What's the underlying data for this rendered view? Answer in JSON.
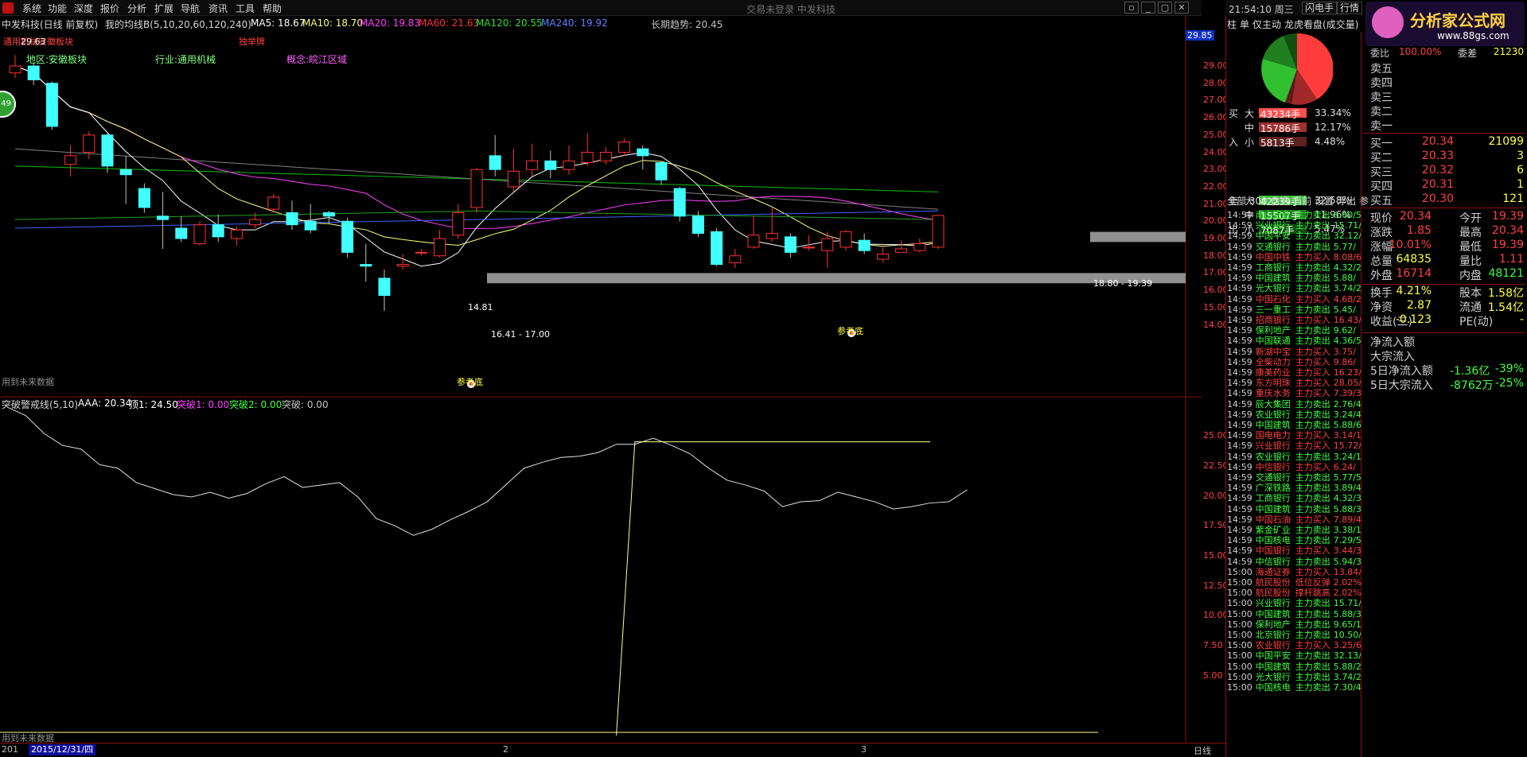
{
  "menu": [
    "系统",
    "功能",
    "深度",
    "报价",
    "分析",
    "扩展",
    "导航",
    "资讯",
    "工具",
    "帮助"
  ],
  "center_title": "交易未登录 中发科技",
  "window_buttons": [
    "▫",
    "_",
    "▢",
    "✕"
  ],
  "header": {
    "stock": "中发科技(日线 前复权)",
    "indicator": "我的均线B(5,10,20,60,120,240)",
    "ma5": "MA5: 18.67",
    "ma10": "MA10: 18.70",
    "ma20": "MA20: 19.83",
    "ma60": "MA60: 21.63",
    "ma120": "MA120: 20.55",
    "ma240": "MA240: 19.92",
    "trend": "长期趋势: 20.45"
  },
  "labels": {
    "sector_top": "通用机械安徽板块",
    "gold": "独举牌",
    "region": "地区:安徽板块",
    "industry": "行业:通用机械",
    "concept": "概念:皖江区域",
    "high_price": "29.63",
    "low_price": "14.81",
    "ref_bottom1": "参考底",
    "ref_bottom2": "参考底",
    "zone1": "16.41 - 17.00",
    "zone2": "18.80 - 19.39",
    "future1": "用到未来数据",
    "future2": "用到未来数据",
    "badge": "49",
    "last_price": "29.85"
  },
  "price_axis": [
    "29.00",
    "28.00",
    "27.00",
    "26.00",
    "25.00",
    "24.00",
    "23.00",
    "22.00",
    "21.00",
    "20.00",
    "19.00",
    "18.00",
    "17.00",
    "16.00",
    "15.00",
    "14.00"
  ],
  "osc_header": {
    "name": "突破警戒线(5,10)",
    "aaa": "AAA: 20.34",
    "top": "顶1: 24.50",
    "b1": "突破1: 0.00",
    "b2": "突破2: 0.00",
    "b3": "突破: 0.00"
  },
  "osc_axis": [
    "25.00",
    "22.50",
    "20.00",
    "17.50",
    "15.00",
    "12.50",
    "10.00",
    "7.50",
    "5.00"
  ],
  "bottom": {
    "year": "201",
    "date": "2015/12/31/四",
    "m2": "2",
    "m3": "3",
    "period": "日线"
  },
  "colors": {
    "up": "#ff3030",
    "down": "#40ffff",
    "ma5": "#ffffff",
    "ma10": "#ffff80",
    "ma20": "#ff40ff",
    "ma60": "#00c000",
    "ma120": "#808080",
    "ma240": "#4060ff"
  },
  "chart_data": [
    {
      "type": "candlestick",
      "series": [
        {
          "o": 28.6,
          "c": 29.0,
          "h": 29.63,
          "l": 28.3
        },
        {
          "o": 29.0,
          "c": 28.2,
          "h": 29.2,
          "l": 27.9
        },
        {
          "o": 28.0,
          "c": 25.5,
          "h": 28.1,
          "l": 25.3
        },
        {
          "o": 23.3,
          "c": 23.8,
          "h": 24.4,
          "l": 22.6
        },
        {
          "o": 24.0,
          "c": 25.0,
          "h": 25.2,
          "l": 23.6
        },
        {
          "o": 25.0,
          "c": 23.2,
          "h": 25.1,
          "l": 22.8
        },
        {
          "o": 23.0,
          "c": 22.7,
          "h": 23.8,
          "l": 21.0
        },
        {
          "o": 21.9,
          "c": 20.8,
          "h": 22.2,
          "l": 20.5
        },
        {
          "o": 20.3,
          "c": 20.1,
          "h": 21.7,
          "l": 18.4
        },
        {
          "o": 19.6,
          "c": 19.0,
          "h": 20.3,
          "l": 18.8
        },
        {
          "o": 18.7,
          "c": 19.8,
          "h": 20.0,
          "l": 18.6
        },
        {
          "o": 19.8,
          "c": 19.1,
          "h": 20.4,
          "l": 18.8
        },
        {
          "o": 19.0,
          "c": 19.5,
          "h": 19.7,
          "l": 18.6
        },
        {
          "o": 19.8,
          "c": 20.1,
          "h": 20.5,
          "l": 19.6
        },
        {
          "o": 20.7,
          "c": 21.4,
          "h": 21.6,
          "l": 20.5
        },
        {
          "o": 20.5,
          "c": 19.8,
          "h": 21.2,
          "l": 19.5
        },
        {
          "o": 20.0,
          "c": 19.5,
          "h": 21.0,
          "l": 19.3
        },
        {
          "o": 20.5,
          "c": 20.3,
          "h": 20.6,
          "l": 19.9
        },
        {
          "o": 20.0,
          "c": 18.2,
          "h": 20.2,
          "l": 17.9
        },
        {
          "o": 17.5,
          "c": 17.4,
          "h": 18.7,
          "l": 16.5
        },
        {
          "o": 16.7,
          "c": 15.7,
          "h": 17.2,
          "l": 14.81
        },
        {
          "o": 17.4,
          "c": 17.5,
          "h": 18.1,
          "l": 17.2
        },
        {
          "o": 18.2,
          "c": 18.2,
          "h": 18.4,
          "l": 18.0
        },
        {
          "o": 18.0,
          "c": 19.0,
          "h": 19.5,
          "l": 17.9
        },
        {
          "o": 19.2,
          "c": 20.5,
          "h": 21.0,
          "l": 19.0
        },
        {
          "o": 20.8,
          "c": 23.0,
          "h": 23.1,
          "l": 20.5
        },
        {
          "o": 23.8,
          "c": 23.0,
          "h": 25.0,
          "l": 22.6
        },
        {
          "o": 22.0,
          "c": 22.9,
          "h": 24.2,
          "l": 21.7
        },
        {
          "o": 23.0,
          "c": 23.5,
          "h": 24.5,
          "l": 22.6
        },
        {
          "o": 23.5,
          "c": 23.0,
          "h": 24.1,
          "l": 22.5
        },
        {
          "o": 23.0,
          "c": 23.5,
          "h": 24.4,
          "l": 22.7
        },
        {
          "o": 23.4,
          "c": 24.0,
          "h": 25.1,
          "l": 23.2
        },
        {
          "o": 23.5,
          "c": 24.0,
          "h": 24.3,
          "l": 23.3
        },
        {
          "o": 24.0,
          "c": 24.6,
          "h": 24.8,
          "l": 23.8
        },
        {
          "o": 24.2,
          "c": 23.8,
          "h": 24.4,
          "l": 23.0
        },
        {
          "o": 23.4,
          "c": 22.4,
          "h": 23.5,
          "l": 22.1
        },
        {
          "o": 21.9,
          "c": 20.3,
          "h": 22.0,
          "l": 20.0
        },
        {
          "o": 20.3,
          "c": 19.3,
          "h": 20.6,
          "l": 19.1
        },
        {
          "o": 19.4,
          "c": 17.5,
          "h": 19.6,
          "l": 17.4
        },
        {
          "o": 17.6,
          "c": 18.0,
          "h": 18.4,
          "l": 17.3
        },
        {
          "o": 18.5,
          "c": 19.2,
          "h": 20.3,
          "l": 18.4
        },
        {
          "o": 19.0,
          "c": 19.3,
          "h": 20.8,
          "l": 18.8
        },
        {
          "o": 19.1,
          "c": 18.2,
          "h": 19.3,
          "l": 17.9
        },
        {
          "o": 18.5,
          "c": 18.5,
          "h": 19.2,
          "l": 18.3
        },
        {
          "o": 18.3,
          "c": 19.0,
          "h": 19.4,
          "l": 17.3
        },
        {
          "o": 18.5,
          "c": 19.4,
          "h": 19.5,
          "l": 18.3
        },
        {
          "o": 18.9,
          "c": 18.3,
          "h": 19.3,
          "l": 18.1
        },
        {
          "o": 17.8,
          "c": 18.1,
          "h": 18.5,
          "l": 17.6
        },
        {
          "o": 18.2,
          "c": 18.4,
          "h": 18.9,
          "l": 18.2
        },
        {
          "o": 18.3,
          "c": 18.7,
          "h": 19.0,
          "l": 18.2
        },
        {
          "o": 18.5,
          "c": 20.34,
          "h": 20.34,
          "l": 18.4
        }
      ]
    },
    {
      "type": "line",
      "name": "突破警戒线",
      "values": [
        27.4,
        26.7,
        25.2,
        24.2,
        23.9,
        22.6,
        22.3,
        21.1,
        20.6,
        20.1,
        19.9,
        20.3,
        19.8,
        20.2,
        21.0,
        21.6,
        20.7,
        20.9,
        21.1,
        19.9,
        18.1,
        17.5,
        16.7,
        17.2,
        18.0,
        18.7,
        19.5,
        20.9,
        22.3,
        22.8,
        23.2,
        23.3,
        23.6,
        24.3,
        24.3,
        24.8,
        24.2,
        23.5,
        22.3,
        21.3,
        20.9,
        20.4,
        19.1,
        19.5,
        19.6,
        20.3,
        19.9,
        19.5,
        18.9,
        19.1,
        19.4,
        19.5,
        20.5
      ],
      "line2": [
        {
          "x": 33,
          "y": 0
        },
        {
          "x": 34,
          "y": 24.5
        },
        {
          "x": 50,
          "y": 24.5
        }
      ],
      "ylim": [
        0,
        27
      ]
    }
  ],
  "right": {
    "clock": "21:54:10 周三",
    "btn1": "闪电手",
    "btn2": "行情",
    "tabs": [
      "柱",
      "单",
      "仅主动",
      "龙虎看盘(成交量)"
    ],
    "fund_rows": [
      {
        "side": "买",
        "size": "大",
        "val": "43234手",
        "pct": "33.34%",
        "color": "#ff5050"
      },
      {
        "side": "",
        "size": "中",
        "val": "15786手",
        "pct": "12.17%",
        "color": "#a03030"
      },
      {
        "side": "入",
        "size": "小",
        "val": "5813手",
        "pct": "4.48%",
        "color": "#602020"
      },
      {
        "side": "卖",
        "size": "大",
        "val": "42239手",
        "pct": "32.58%",
        "color": "#40c040"
      },
      {
        "side": "",
        "size": "中",
        "val": "15507手",
        "pct": "11.96%",
        "color": "#208020"
      },
      {
        "side": "出",
        "size": "小",
        "val": "7087手",
        "pct": "5.47%",
        "color": "#105010"
      }
    ],
    "list_tabs": [
      "全部",
      "300",
      "自选",
      "当前",
      "设置",
      "浮出",
      "参"
    ],
    "ticks": [
      {
        "t": "14:59",
        "n": "南山铝业",
        "a": "主力卖出",
        "v": "6.60/5",
        "buy": false
      },
      {
        "t": "14:59",
        "n": "兴业银行",
        "a": "主力卖出",
        "v": "15.71/",
        "buy": false
      },
      {
        "t": "14:59",
        "n": "中国平安",
        "a": "主力卖出",
        "v": "32.12/",
        "buy": false
      },
      {
        "t": "14:59",
        "n": "交通银行",
        "a": "主力卖出",
        "v": "5.77/",
        "buy": false
      },
      {
        "t": "14:59",
        "n": "中国中铁",
        "a": "主力买入",
        "v": "8.08/6",
        "buy": true
      },
      {
        "t": "14:59",
        "n": "工商银行",
        "a": "主力卖出",
        "v": "4.32/2",
        "buy": false
      },
      {
        "t": "14:59",
        "n": "中国建筑",
        "a": "主力卖出",
        "v": "5.88/",
        "buy": false
      },
      {
        "t": "14:59",
        "n": "光大银行",
        "a": "主力卖出",
        "v": "3.74/2",
        "buy": false
      },
      {
        "t": "14:59",
        "n": "中国石化",
        "a": "主力买入",
        "v": "4.68/2",
        "buy": true
      },
      {
        "t": "14:59",
        "n": "三一重工",
        "a": "主力卖出",
        "v": "5.45/",
        "buy": false
      },
      {
        "t": "14:59",
        "n": "招商银行",
        "a": "主力买入",
        "v": "16.43/",
        "buy": true
      },
      {
        "t": "14:59",
        "n": "保利地产",
        "a": "主力卖出",
        "v": "9.62/",
        "buy": false
      },
      {
        "t": "14:59",
        "n": "中国联通",
        "a": "主力卖出",
        "v": "4.36/5",
        "buy": false
      },
      {
        "t": "14:59",
        "n": "新湖中宝",
        "a": "主力买入",
        "v": "3.75/",
        "buy": true
      },
      {
        "t": "14:59",
        "n": "全柴动力",
        "a": "主力买入",
        "v": "9.86/",
        "buy": true
      },
      {
        "t": "14:59",
        "n": "康美药业",
        "a": "主力买入",
        "v": "16.23/",
        "buy": true
      },
      {
        "t": "14:59",
        "n": "东方明珠",
        "a": "主力买入",
        "v": "28.05/",
        "buy": true
      },
      {
        "t": "14:59",
        "n": "重庆水务",
        "a": "主力买入",
        "v": "7.39/3",
        "buy": true
      },
      {
        "t": "14:59",
        "n": "辰大集团",
        "a": "主力卖出",
        "v": "2.76/4",
        "buy": false
      },
      {
        "t": "14:59",
        "n": "农业银行",
        "a": "主力卖出",
        "v": "3.24/4",
        "buy": false
      },
      {
        "t": "14:59",
        "n": "中国建筑",
        "a": "主力卖出",
        "v": "5.88/6",
        "buy": false
      },
      {
        "t": "14:59",
        "n": "国电电力",
        "a": "主力买入",
        "v": "3.14/1",
        "buy": true
      },
      {
        "t": "14:59",
        "n": "兴业银行",
        "a": "主力买入",
        "v": "15.72/",
        "buy": true
      },
      {
        "t": "14:59",
        "n": "农业银行",
        "a": "主力卖出",
        "v": "3.24/1",
        "buy": false
      },
      {
        "t": "14:59",
        "n": "中信银行",
        "a": "主力买入",
        "v": "6.24/",
        "buy": true
      },
      {
        "t": "14:59",
        "n": "交通银行",
        "a": "主力卖出",
        "v": "5.77/5",
        "buy": false
      },
      {
        "t": "14:59",
        "n": "广深铁路",
        "a": "主力卖出",
        "v": "3.89/4",
        "buy": false
      },
      {
        "t": "14:59",
        "n": "工商银行",
        "a": "主力卖出",
        "v": "4.32/3",
        "buy": false
      },
      {
        "t": "14:59",
        "n": "中国建筑",
        "a": "主力卖出",
        "v": "5.88/3",
        "buy": false
      },
      {
        "t": "14:59",
        "n": "中国石油",
        "a": "主力买入",
        "v": "7.89/4",
        "buy": true
      },
      {
        "t": "14:59",
        "n": "紫金矿业",
        "a": "主力卖出",
        "v": "3.38/1",
        "buy": false
      },
      {
        "t": "14:59",
        "n": "中国核电",
        "a": "主力卖出",
        "v": "7.29/5",
        "buy": false
      },
      {
        "t": "14:59",
        "n": "中国银行",
        "a": "主力买入",
        "v": "3.44/3",
        "buy": true
      },
      {
        "t": "14:59",
        "n": "中信银行",
        "a": "主力卖出",
        "v": "5.94/3",
        "buy": false
      },
      {
        "t": "15:00",
        "n": "海通证券",
        "a": "主力买入",
        "v": "13.84/",
        "buy": true
      },
      {
        "t": "15:00",
        "n": "航民股份",
        "a": "低位反弹",
        "v": "2.02%",
        "buy": true
      },
      {
        "t": "15:00",
        "n": "航民股份",
        "a": "撑杆跳高",
        "v": "2.02%",
        "buy": true
      },
      {
        "t": "15:00",
        "n": "兴业银行",
        "a": "主力卖出",
        "v": "15.71/",
        "buy": false
      },
      {
        "t": "15:00",
        "n": "中国建筑",
        "a": "主力卖出",
        "v": "5.88/3",
        "buy": false
      },
      {
        "t": "15:00",
        "n": "保利地产",
        "a": "主力卖出",
        "v": "9.65/1",
        "buy": false
      },
      {
        "t": "15:00",
        "n": "北京银行",
        "a": "主力卖出",
        "v": "10.50/",
        "buy": false
      },
      {
        "t": "15:00",
        "n": "农业银行",
        "a": "主力买入",
        "v": "3.25/6",
        "buy": true
      },
      {
        "t": "15:00",
        "n": "中国平安",
        "a": "主力卖出",
        "v": "32.13/",
        "buy": false
      },
      {
        "t": "15:00",
        "n": "中国建筑",
        "a": "主力卖出",
        "v": "5.88/2",
        "buy": false
      },
      {
        "t": "15:00",
        "n": "光大银行",
        "a": "主力卖出",
        "v": "3.74/2",
        "buy": false
      },
      {
        "t": "15:00",
        "n": "中国核电",
        "a": "主力卖出",
        "v": "7.30/4",
        "buy": false
      }
    ],
    "committee_label": "委比",
    "committee_val": "100.00%",
    "committee_label2": "委差",
    "committee_val2": "21230",
    "asks": [
      "卖五",
      "卖四",
      "卖三",
      "卖二",
      "卖一"
    ],
    "bids": [
      {
        "l": "买一",
        "p": "20.34",
        "v": "21099"
      },
      {
        "l": "买二",
        "p": "20.33",
        "v": "3"
      },
      {
        "l": "买三",
        "p": "20.32",
        "v": "6"
      },
      {
        "l": "买四",
        "p": "20.31",
        "v": "1"
      },
      {
        "l": "买五",
        "p": "20.30",
        "v": "121"
      }
    ],
    "stats": [
      {
        "a": "现价",
        "b": "20.34",
        "c": "今开",
        "d": "19.39",
        "bc": "#ff4040",
        "dc": "#ff4040"
      },
      {
        "a": "涨跌",
        "b": "1.85",
        "c": "最高",
        "d": "20.34",
        "bc": "#ff4040",
        "dc": "#ff4040"
      },
      {
        "a": "涨幅",
        "b": "10.01%",
        "c": "最低",
        "d": "19.39",
        "bc": "#ff4040",
        "dc": "#ff4040"
      },
      {
        "a": "总量",
        "b": "64835",
        "c": "量比",
        "d": "1.11",
        "bc": "#ffff40",
        "dc": "#ff4040"
      },
      {
        "a": "外盘",
        "b": "16714",
        "c": "内盘",
        "d": "48121",
        "bc": "#ff4040",
        "dc": "#40ff40"
      },
      {
        "a": "换手",
        "b": "4.21%",
        "c": "股本",
        "d": "1.58亿",
        "bc": "#ffff40",
        "dc": "#ffff40"
      },
      {
        "a": "净资",
        "b": "2.87",
        "c": "流通",
        "d": "1.54亿",
        "bc": "#ffff40",
        "dc": "#ffff40"
      },
      {
        "a": "收益(三)",
        "b": "-0.123",
        "c": "PE(动)",
        "d": "-",
        "bc": "#ffff40",
        "dc": "#ffff40"
      }
    ],
    "flow": [
      {
        "a": "净流入额",
        "b": "",
        "d": ""
      },
      {
        "a": "大宗流入",
        "b": "",
        "d": ""
      },
      {
        "a": "5日净流入额",
        "b": "-1.36亿",
        "d": "-39%"
      },
      {
        "a": "5日大宗流入",
        "b": "-8762万",
        "d": "-25%"
      }
    ],
    "logo_text": "分析家公式网",
    "logo_url": "www.88gs.com"
  }
}
